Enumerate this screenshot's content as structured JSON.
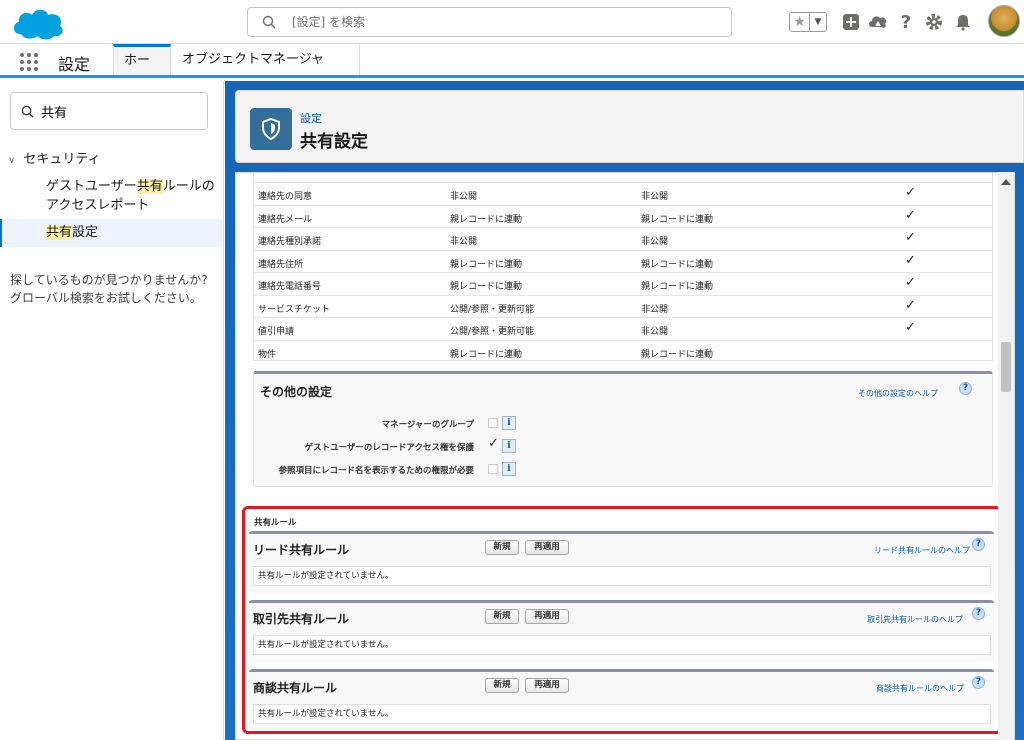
{
  "header": {
    "search_placeholder": "[設定] を検索",
    "icons": [
      "star-icon",
      "caret-down-icon",
      "add-icon",
      "trailhead-icon",
      "help-icon",
      "setup-gear-icon",
      "notification-bell-icon",
      "avatar"
    ]
  },
  "nav": {
    "app_name": "設定",
    "tabs": [
      {
        "label": "ホーム",
        "active": true
      },
      {
        "label": "オブジェクトマネージャー",
        "active": false
      }
    ]
  },
  "sidebar": {
    "quickfind_value": "共有",
    "section_label": "セキュリティ",
    "items": [
      {
        "pre": "ゲストユーザー",
        "hl": "共有",
        "post": "ルールのアクセスレポート"
      },
      {
        "pre": "",
        "hl": "共有",
        "post": "設定"
      }
    ],
    "not_found_line1": "探しているものが見つかりませんか?",
    "not_found_line2": "グローバル検索をお試しください。"
  },
  "page": {
    "eyebrow": "設定",
    "title": "共有設定"
  },
  "org_defaults": {
    "rows": [
      {
        "object": "連絡先の同意",
        "internal": "非公開",
        "external": "非公開",
        "hierarchy": "✓"
      },
      {
        "object": "連絡先メール",
        "internal": "親レコードに連動",
        "external": "親レコードに連動",
        "hierarchy": "✓"
      },
      {
        "object": "連絡先種別承諾",
        "internal": "非公開",
        "external": "非公開",
        "hierarchy": "✓"
      },
      {
        "object": "連絡先住所",
        "internal": "親レコードに連動",
        "external": "親レコードに連動",
        "hierarchy": "✓"
      },
      {
        "object": "連絡先電話番号",
        "internal": "親レコードに連動",
        "external": "親レコードに連動",
        "hierarchy": "✓"
      },
      {
        "object": "サービスチケット",
        "internal": "公開/参照・更新可能",
        "external": "非公開",
        "hierarchy": "✓"
      },
      {
        "object": "値引申請",
        "internal": "公開/参照・更新可能",
        "external": "非公開",
        "hierarchy": "✓"
      },
      {
        "object": "物件",
        "internal": "親レコードに連動",
        "external": "親レコードに連動",
        "hierarchy": ""
      }
    ]
  },
  "other_settings": {
    "title": "その他の設定",
    "help": "その他の設定のヘルプ",
    "help_q": "?",
    "info": "i",
    "rows": [
      {
        "label": "マネージャーのグループ",
        "checked": false
      },
      {
        "label": "ゲストユーザーのレコードアクセス権を保護",
        "checked": true,
        "mark": "✓"
      },
      {
        "label": "参照項目にレコード名を表示するための権限が必要",
        "checked": false
      }
    ]
  },
  "sharing_rules": {
    "heading": "共有ルール",
    "new_label": "新規",
    "reapply_label": "再適用",
    "empty_text": "共有ルールが設定されていません。",
    "rules": [
      {
        "title": "リード共有ルール",
        "help": "リード共有ルールのヘルプ"
      },
      {
        "title": "取引先共有ルール",
        "help": "取引先共有ルールのヘルプ"
      },
      {
        "title": "商談共有ルール",
        "help": "商談共有ルールのヘルプ"
      }
    ]
  },
  "colors": {
    "brand": "#1b96ff",
    "header_icon": "#356f99",
    "highlight_box": "#e0181f",
    "link": "#015ba7"
  }
}
